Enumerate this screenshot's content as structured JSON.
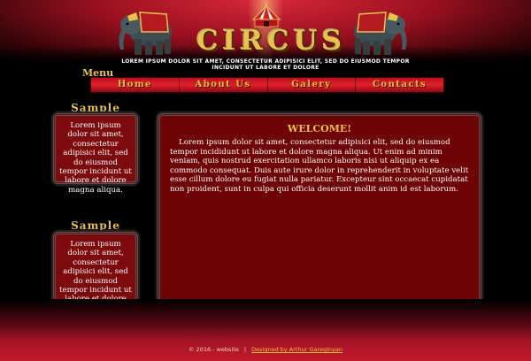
{
  "header": {
    "logo_text": "CIRCUS",
    "tagline": "Lorem ipsum dolor sit amet, consectetur adipisici elit, sed do eiusmod tempor incidunt ut labore et dolore"
  },
  "menu": {
    "label": "Menu",
    "items": [
      {
        "label": "Home"
      },
      {
        "label": "About Us"
      },
      {
        "label": "Galery"
      },
      {
        "label": "Contacts"
      }
    ]
  },
  "sidebar": [
    {
      "title": "Sample",
      "text": "Lorem ipsum dolor sit amet, consectetur adipisici elit, sed do eiusmod tempor incidunt ut labore et dolore magna aliqua."
    },
    {
      "title": "Sample",
      "text": "Lorem ipsum dolor sit amet, consectetur adipisici elit, sed do eiusmod tempor incidunt ut labore et dolore magna aliqua."
    }
  ],
  "main": {
    "title": "WELCOME!",
    "text": "Lorem ipsum dolor sit amet, consectetur adipisici elit, sed do eiusmod tempor incididunt ut labore et dolore magna aliqua. Ut enim ad minim veniam, quis nostrud exercitation ullamco laboris nisi ut aliquip ex ea commodo consequat. Duis aute irure dolor in reprehenderit in voluptate velit esse cillum dolore eu fugiat nulla pariatur. Excepteur sint occaecat cupidatat non proident, sunt in culpa qui officia deserunt mollit anim id est laborum."
  },
  "footer": {
    "copyright": "© 2016 - website",
    "separator": "|",
    "credit": "Designed by Arthur Gareginyan"
  },
  "colors": {
    "accent_gold": "#e8c24a",
    "content_red": "#6f0407",
    "nav_red": "#e0202c"
  }
}
